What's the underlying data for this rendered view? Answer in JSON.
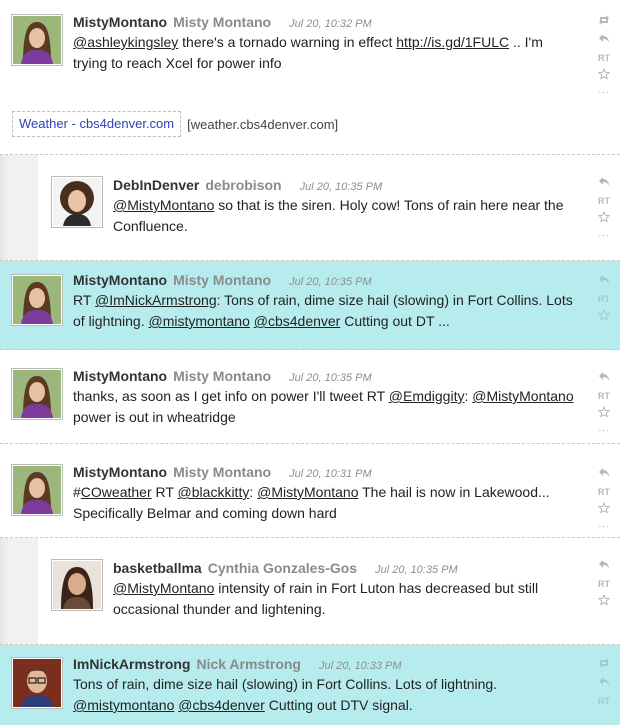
{
  "tweets": [
    {
      "username": "MistyMontano",
      "fullname": "Misty Montano",
      "time": "Jul 20, 10:32 PM",
      "text": [
        {
          "t": "@ashleykingsley",
          "link": true
        },
        {
          "t": " there's a tornado warning in effect ",
          "link": false
        },
        {
          "t": "http://is.gd/1FULC",
          "link": true
        },
        {
          "t": " .. I'm trying to reach Xcel for power info",
          "link": false
        }
      ],
      "preview_title": "Weather - cbs4denver.com",
      "preview_url": "[weather.cbs4denver.com]"
    },
    {
      "username": "DebInDenver",
      "fullname": "debrobison",
      "time": "Jul 20, 10:35 PM",
      "text": [
        {
          "t": "@MistyMontano",
          "link": true
        },
        {
          "t": " so that is the siren. Holy cow! Tons of rain here near the Confluence.",
          "link": false
        }
      ]
    },
    {
      "username": "MistyMontano",
      "fullname": "Misty Montano",
      "time": "Jul 20, 10:35 PM",
      "text": [
        {
          "t": "RT ",
          "link": false
        },
        {
          "t": "@ImNickArmstrong",
          "link": true
        },
        {
          "t": ": Tons of rain, dime size hail (slowing) in Fort Collins. Lots of lightning. ",
          "link": false
        },
        {
          "t": "@mistymontano",
          "link": true
        },
        {
          "t": " ",
          "link": false
        },
        {
          "t": "@cbs4denver",
          "link": true
        },
        {
          "t": " Cutting out DT ...",
          "link": false
        }
      ]
    },
    {
      "username": "MistyMontano",
      "fullname": "Misty Montano",
      "time": "Jul 20, 10:35 PM",
      "text": [
        {
          "t": "thanks, as soon as I get info on power I'll tweet RT ",
          "link": false
        },
        {
          "t": "@Emdiggity",
          "link": true
        },
        {
          "t": ": ",
          "link": false
        },
        {
          "t": "@MistyMontano",
          "link": true
        },
        {
          "t": " power is out in wheatridge",
          "link": false
        }
      ]
    },
    {
      "username": "MistyMontano",
      "fullname": "Misty Montano",
      "time": "Jul 20, 10:31 PM",
      "text": [
        {
          "t": "#",
          "link": false
        },
        {
          "t": "COweather",
          "link": true
        },
        {
          "t": " RT ",
          "link": false
        },
        {
          "t": "@blackkitty",
          "link": true
        },
        {
          "t": ": ",
          "link": false
        },
        {
          "t": "@MistyMontano",
          "link": true
        },
        {
          "t": " The hail is now in Lakewood... Specifically Belmar and coming down hard",
          "link": false
        }
      ]
    },
    {
      "username": "basketballma",
      "fullname": "Cynthia Gonzales-Gos",
      "time": "Jul 20, 10:35 PM",
      "text": [
        {
          "t": "@MistyMontano",
          "link": true
        },
        {
          "t": " intensity of rain in Fort Luton has decreased but still occasional thunder and lightening.",
          "link": false
        }
      ]
    },
    {
      "username": "ImNickArmstrong",
      "fullname": "Nick Armstrong",
      "time": "Jul 20, 10:33 PM",
      "text": [
        {
          "t": "Tons of rain, dime size hail (slowing) in Fort Collins. Lots of lightning. ",
          "link": false
        },
        {
          "t": "@mistymontano",
          "link": true
        },
        {
          "t": " ",
          "link": false
        },
        {
          "t": "@cbs4denver",
          "link": true
        },
        {
          "t": " Cutting out DTV signal.",
          "link": false
        }
      ]
    }
  ],
  "actions": {
    "retweet_label": "RT",
    "more_label": "...",
    "icons": [
      "retweet-arrows-icon",
      "reply-arrow-icon",
      "rt-text-icon",
      "favorite-star-icon",
      "more-dots-icon"
    ]
  },
  "colors": {
    "highlight_bg": "#b7ecef",
    "link_preview": "#2a44b5"
  }
}
